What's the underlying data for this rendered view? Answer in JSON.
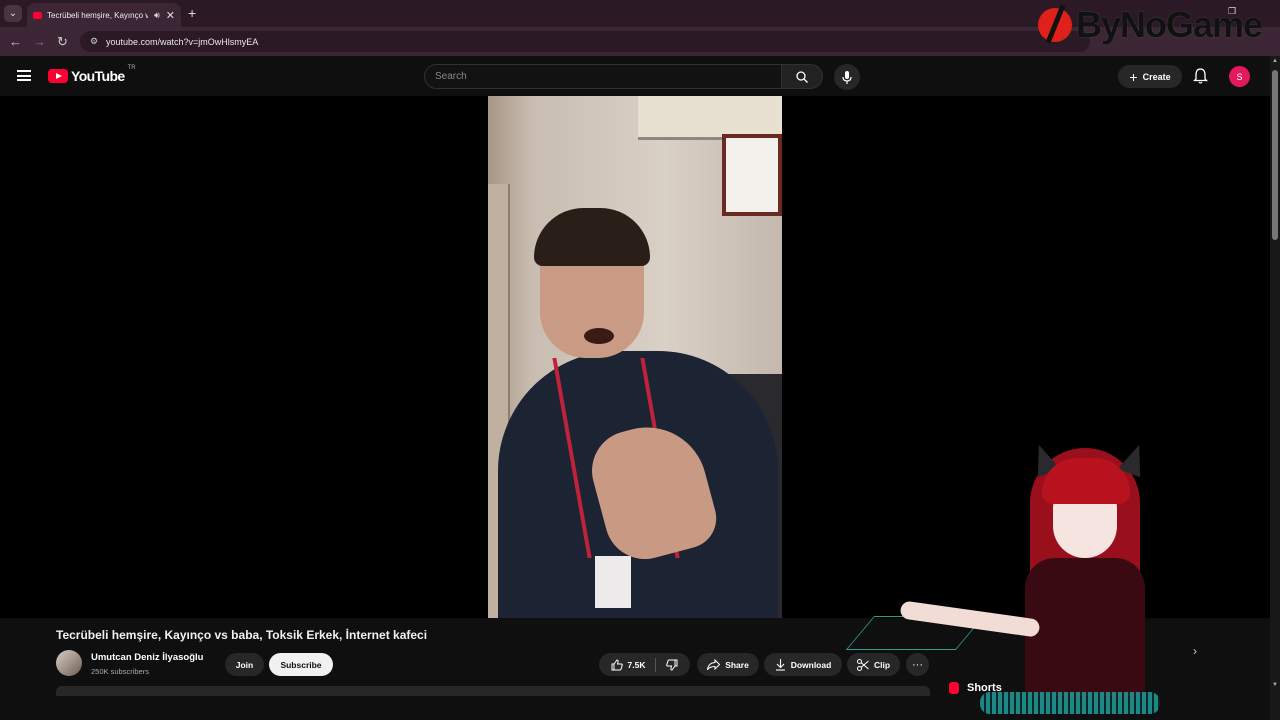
{
  "browser": {
    "tab_title": "Tecrübeli hemşire, Kayınço vs baba, Toksik Erkek, İnternet kafeci",
    "url": "youtube.com/watch?v=jmOwHlsmyEA"
  },
  "overlay_brand": "ByNoGame",
  "youtube": {
    "logo_text": "YouTube",
    "country_code": "TR",
    "search_placeholder": "Search",
    "create_label": "Create",
    "avatar_letter": "S"
  },
  "video": {
    "title": "Tecrübeli hemşire, Kayınço vs baba, Toksik Erkek, İnternet kafeci",
    "channel_name": "Umutcan Deniz İlyasoğlu",
    "subscribers": "250K subscribers",
    "join_label": "Join",
    "subscribe_label": "Subscribe",
    "likes": "7.5K",
    "share_label": "Share",
    "download_label": "Download",
    "clip_label": "Clip",
    "more_label": "···"
  },
  "sidebar": {
    "shorts_label": "Shorts"
  },
  "colors": {
    "accent_red": "#ff0033",
    "background": "#0f0f0f",
    "chrome_bg": "#3c2636"
  }
}
